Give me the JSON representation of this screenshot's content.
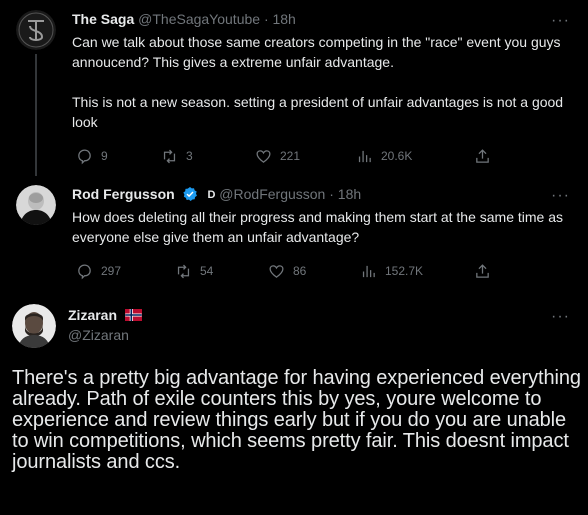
{
  "tweets": [
    {
      "name": "The Saga",
      "handle": "@TheSagaYoutube",
      "time": "· 18h",
      "more": "···",
      "text": "Can we talk about those same creators competing in the \"race\" event you guys annoucend? This gives a extreme unfair advantage.\n\nThis is not a new season. setting a president of unfair advantages is not a good look",
      "replies": "9",
      "retweets": "3",
      "likes": "221",
      "views": "20.6K",
      "avatar_icon": "the-saga-logo-icon"
    },
    {
      "name": "Rod Fergusson",
      "badge": "D",
      "handle": "@RodFergusson",
      "time": "· 18h",
      "more": "···",
      "text": "How does deleting all their progress and making them start at the same time as everyone else give them an unfair advantage?",
      "replies": "297",
      "retweets": "54",
      "likes": "86",
      "views": "152.7K",
      "verified_icon": "verified-badge-icon"
    },
    {
      "name": "Zizaran",
      "handle": "@Zizaran",
      "more": "···",
      "text": "There's a pretty big advantage for having experienced everything already. Path of exile counters this by yes, youre welcome to experience and review things early but if you do you are unable to win competitions, which seems pretty fair. This doesnt impact journalists and ccs.",
      "flag_icon": "norway-flag-icon"
    }
  ],
  "colors": {
    "background": "#000000",
    "text": "#e7e9ea",
    "muted": "#71767b",
    "verified": "#1d9bf0",
    "thread_line": "#333639"
  }
}
